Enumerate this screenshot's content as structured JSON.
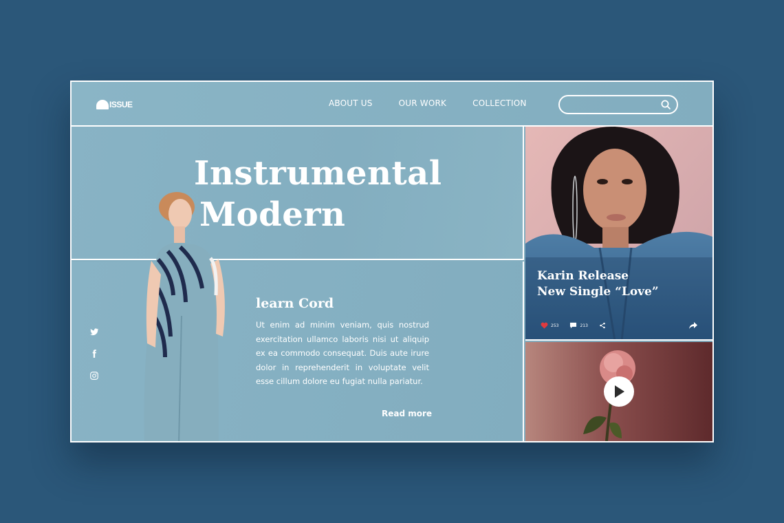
{
  "brand": {
    "logo_text": "ISSUE"
  },
  "nav": {
    "items": [
      {
        "label": "ABOUT US"
      },
      {
        "label": "OUR WORK"
      },
      {
        "label": "COLLECTION"
      }
    ]
  },
  "search": {
    "value": "",
    "placeholder": "",
    "icon": "search-icon"
  },
  "hero": {
    "title_line1": "Instrumental",
    "title_line2": "Modern"
  },
  "article": {
    "title": "learn Cord",
    "body": "Ut enim ad minim veniam, quis nostrud exercitation ullamco laboris nisi ut aliquip ex ea commodo consequat. Duis aute irure dolor in reprehenderit in voluptate velit esse cillum dolore eu fugiat nulla pariatur.",
    "read_more": "Read more"
  },
  "social": {
    "icons": [
      "twitter-icon",
      "facebook-icon",
      "instagram-icon"
    ]
  },
  "feature_card": {
    "title_line1": "Karin Release",
    "title_line2": "New Single “Love”",
    "likes": "253",
    "comments": "213"
  },
  "video_card": {
    "icon": "play-icon"
  },
  "colors": {
    "background": "#2b5779",
    "panel": "#82adbf",
    "accent_heart": "#e03a3e",
    "video_bg": "#6e3536"
  }
}
